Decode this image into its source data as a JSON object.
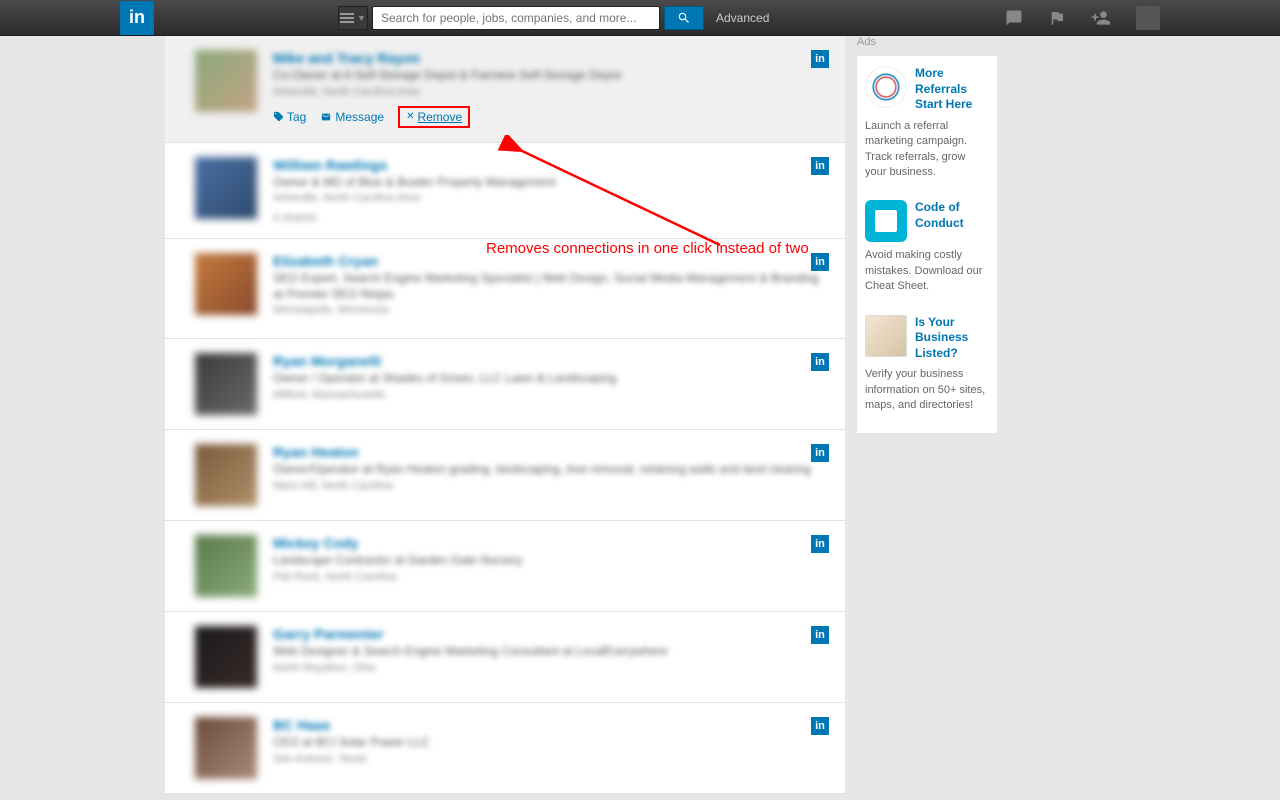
{
  "header": {
    "search_placeholder": "Search for people, jobs, companies, and more...",
    "advanced_label": "Advanced"
  },
  "annotation": {
    "text": "Removes connections in one click instead of two"
  },
  "actions": {
    "tag": "Tag",
    "message": "Message",
    "remove": "Remove"
  },
  "connections": [
    {
      "name": "Mike and Tracy Rayon",
      "title": "Co-Owner at A Self-Storage Depot & Fairview Self-Storage Depot",
      "location": "Asheville, North Carolina Area",
      "highlighted": true,
      "show_actions": true,
      "photo_class": "p1"
    },
    {
      "name": "William Rawlings",
      "title": "Owner & MD of Blue & Bowler Property Management",
      "location": "Asheville, North Carolina Area",
      "shared": "4 shared",
      "photo_class": "p2"
    },
    {
      "name": "Elizabeth Cryan",
      "title": "SEO Expert, Search Engine Marketing Specialist | Web Design, Social Media Management & Branding at Premier SEO Ninjas",
      "location": "Minneapolis, Minnesota",
      "photo_class": "p3"
    },
    {
      "name": "Ryan Morganelli",
      "title": "Owner / Operator at Shades of Green, LLC Lawn & Landscaping",
      "location": "Milford, Massachusetts",
      "photo_class": "p4"
    },
    {
      "name": "Ryan Heaton",
      "title": "Owner/Operator at Ryan Heaton grading, landscaping, tree removal, retaining walls and land clearing",
      "location": "Mars Hill, North Carolina",
      "photo_class": "p5"
    },
    {
      "name": "Mickey Cody",
      "title": "Landscape Contractor at Garden Gate Nursery",
      "location": "Flat Rock, North Carolina",
      "photo_class": "p6"
    },
    {
      "name": "Garry Parmenter",
      "title": "Web Designer & Search Engine Marketing Consultant at LocalEverywhere",
      "location": "North Royalton, Ohio",
      "photo_class": "p7"
    },
    {
      "name": "BC Haas",
      "title": "CEO at BCI Solar Power LLC",
      "location": "San Antonio, Texas",
      "photo_class": "p8"
    }
  ],
  "sidebar": {
    "ads_label": "Ads",
    "ads": [
      {
        "title": "More Referrals Start Here",
        "desc": "Launch a referral marketing campaign. Track referrals, grow your business.",
        "img_class": "a1"
      },
      {
        "title": "Code of Conduct",
        "desc": "Avoid making costly mistakes. Download our Cheat Sheet.",
        "img_class": "a2"
      },
      {
        "title": "Is Your Business Listed?",
        "desc": "Verify your business information on 50+ sites, maps, and directories!",
        "img_class": "a3"
      }
    ]
  }
}
